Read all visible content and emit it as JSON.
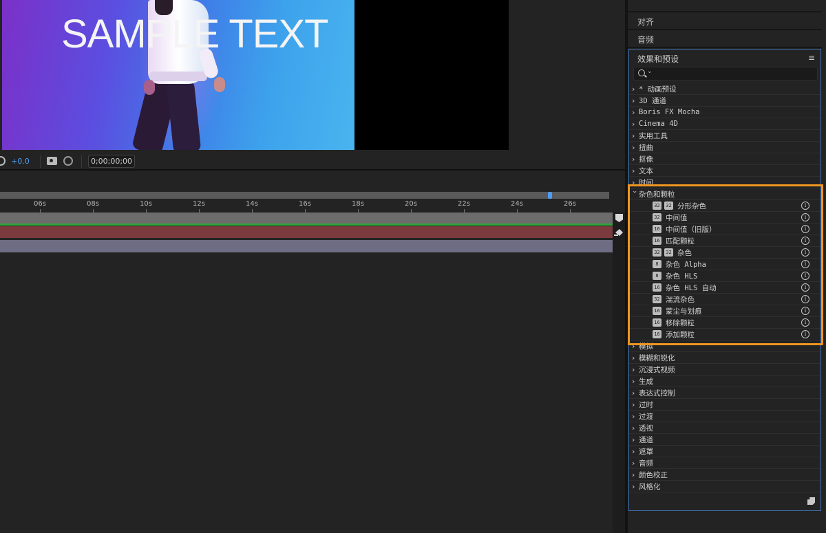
{
  "viewer": {
    "sample_text": "SAMPLE TEXT",
    "exposure": "+0.0",
    "timecode": "0;00;00;00"
  },
  "timeline": {
    "ticks": [
      "06s",
      "08s",
      "10s",
      "12s",
      "14s",
      "16s",
      "18s",
      "20s",
      "22s",
      "24s",
      "26s"
    ],
    "colors": {
      "green_track": "#2fa43a",
      "red_track": "#7a3a3e",
      "violet_track": "#6f6d84",
      "playhead": "#4f9cf6"
    }
  },
  "panels": {
    "align": "对齐",
    "audio": "音频",
    "effects": {
      "title": "效果和预设",
      "search_placeholder": "",
      "menu_icon": "hamburger-menu-icon",
      "categories": [
        "* 动画预设",
        "3D 通道",
        "Boris FX Mocha",
        "Cinema 4D",
        "实用工具",
        "扭曲",
        "抠像",
        "文本",
        "时间",
        "杂色和颗粒",
        "模拟",
        "模糊和锐化",
        "沉浸式视频",
        "生成",
        "表达式控制",
        "过时",
        "过渡",
        "透视",
        "通道",
        "遮罩",
        "音频",
        "颜色校正",
        "风格化"
      ],
      "expanded_category": "杂色和颗粒",
      "noise_effects": [
        {
          "badges": [
            "32",
            "32"
          ],
          "label": "分形杂色"
        },
        {
          "badges": [
            "32"
          ],
          "label": "中间值"
        },
        {
          "badges": [
            "16"
          ],
          "label": "中间值（旧版）"
        },
        {
          "badges": [
            "16"
          ],
          "label": "匹配颗粒"
        },
        {
          "badges": [
            "32",
            "32"
          ],
          "label": "杂色"
        },
        {
          "badges": [
            "8"
          ],
          "label": "杂色 Alpha"
        },
        {
          "badges": [
            "8"
          ],
          "label": "杂色 HLS"
        },
        {
          "badges": [
            "16"
          ],
          "label": "杂色 HLS 自动"
        },
        {
          "badges": [
            "32"
          ],
          "label": "湍流杂色"
        },
        {
          "badges": [
            "16"
          ],
          "label": "蒙尘与划痕"
        },
        {
          "badges": [
            "16"
          ],
          "label": "移除颗粒"
        },
        {
          "badges": [
            "16"
          ],
          "label": "添加颗粒"
        }
      ],
      "highlight_color": "#f0961f",
      "panel_border_color": "#3d6ea8"
    }
  }
}
